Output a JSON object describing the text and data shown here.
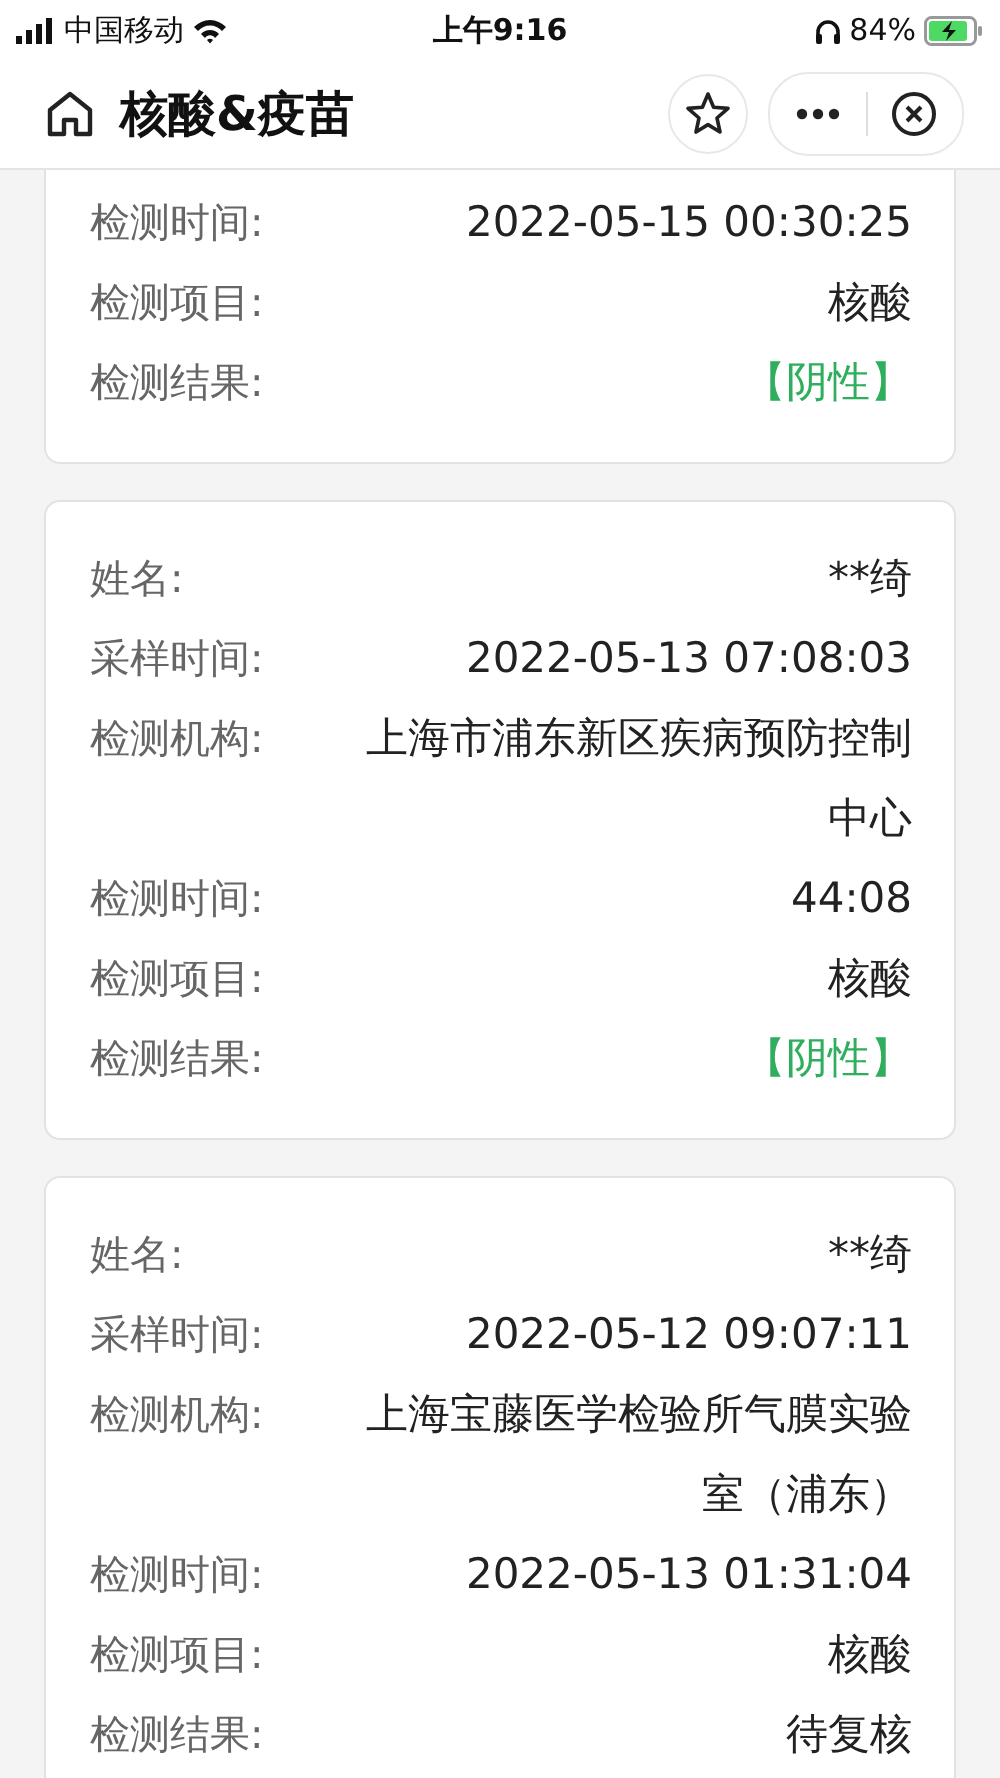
{
  "status_bar": {
    "carrier": "中国移动",
    "time": "上午9:16",
    "battery": "84%"
  },
  "nav_bar": {
    "title": "核酸&疫苗"
  },
  "cards": [
    {
      "rows": [
        {
          "label": "检测时间:",
          "value": "2022-05-15 00:30:25",
          "kind": "plain"
        },
        {
          "label": "检测项目:",
          "value": "核酸",
          "kind": "plain"
        },
        {
          "label": "检测结果:",
          "value": "【阴性】",
          "kind": "negative"
        }
      ]
    },
    {
      "rows": [
        {
          "label": "姓名:",
          "value": "**绮",
          "kind": "plain"
        },
        {
          "label": "采样时间:",
          "value": "2022-05-13 07:08:03",
          "kind": "plain"
        },
        {
          "label": "检测机构:",
          "value": "上海市浦东新区疾病预防控制中心",
          "kind": "plain"
        },
        {
          "label": "检测时间:",
          "value": "44:08",
          "kind": "plain"
        },
        {
          "label": "检测项目:",
          "value": "核酸",
          "kind": "plain"
        },
        {
          "label": "检测结果:",
          "value": "【阴性】",
          "kind": "negative"
        }
      ]
    },
    {
      "rows": [
        {
          "label": "姓名:",
          "value": "**绮",
          "kind": "plain"
        },
        {
          "label": "采样时间:",
          "value": "2022-05-12 09:07:11",
          "kind": "plain"
        },
        {
          "label": "检测机构:",
          "value": "上海宝藤医学检验所气膜实验室（浦东）",
          "kind": "plain"
        },
        {
          "label": "检测时间:",
          "value": "2022-05-13 01:31:04",
          "kind": "plain"
        },
        {
          "label": "检测项目:",
          "value": "核酸",
          "kind": "plain"
        },
        {
          "label": "检测结果:",
          "value": "待复核",
          "kind": "plain"
        }
      ]
    }
  ]
}
